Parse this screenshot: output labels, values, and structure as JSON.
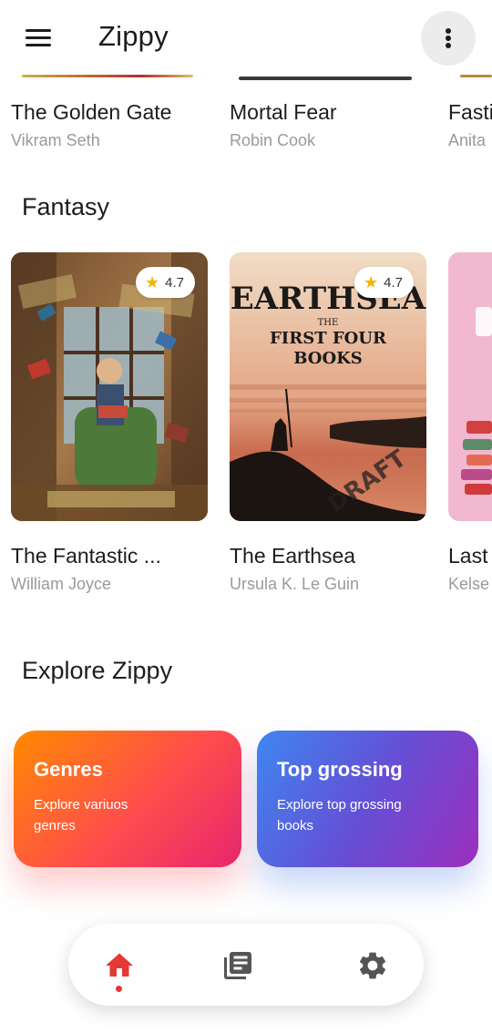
{
  "app": {
    "title": "Zippy"
  },
  "icons": {
    "menu": "hamburger-icon",
    "more": "more-vert-icon",
    "star": "star-icon",
    "home": "home-icon",
    "library": "library-books-icon",
    "settings": "gear-icon"
  },
  "colors": {
    "accent": "#e53935",
    "star": "#f4b400",
    "genres_start": "#ff8a00",
    "genres_end": "#e8266d",
    "top_start": "#3f86f0",
    "top_end": "#9b2fbd"
  },
  "top_row": [
    {
      "title": "The Golden Gate",
      "author": "Vikram Seth"
    },
    {
      "title": "Mortal Fear",
      "author": "Robin Cook"
    },
    {
      "title": "Fasti",
      "author": "Anita"
    }
  ],
  "fantasy": {
    "title": "Fantasy",
    "books": [
      {
        "title": "The Fantastic ...",
        "author": "William Joyce",
        "rating": "4.7"
      },
      {
        "title": "The Earthsea",
        "author": "Ursula K. Le Guin",
        "rating": "4.7",
        "cover_text": {
          "title": "EARTHSEA",
          "subtitle_1": "THE",
          "subtitle_2": "FIRST FOUR",
          "subtitle_3": "BOOKS",
          "stamp": "DRAFT"
        }
      },
      {
        "title": "Last",
        "author": "Kelse"
      }
    ]
  },
  "explore": {
    "title": "Explore Zippy",
    "cards": [
      {
        "title": "Genres",
        "desc": "Explore variuos genres"
      },
      {
        "title": "Top grossing",
        "desc": "Explore top grossing books"
      }
    ]
  }
}
